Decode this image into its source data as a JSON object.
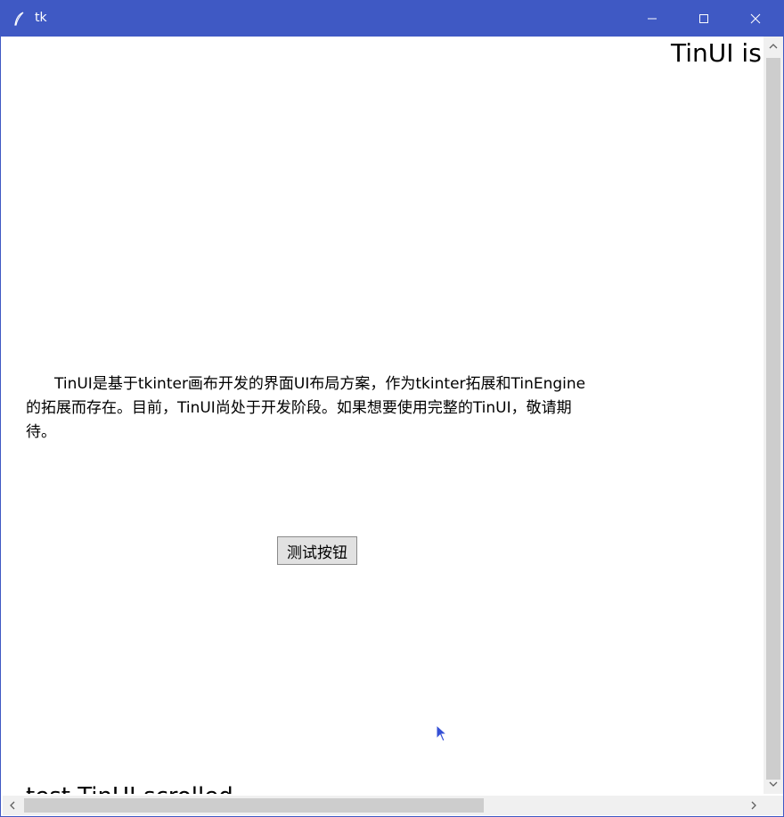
{
  "window": {
    "title": "tk",
    "icon": "feather-icon",
    "controls": [
      "minimize-icon",
      "maximize-icon",
      "close-icon"
    ]
  },
  "canvas": {
    "top_right_text": "TinUI is",
    "paragraph": "TinUI是基于tkinter画布开发的界面UI布局方案，作为tkinter拓展和TinEngine的拓展而存在。目前，TinUI尚处于开发阶段。如果想要使用完整的TinUI，敬请期待。",
    "button_label": "测试按钮",
    "bottom_text": "test TinUI scrolled"
  },
  "colors": {
    "titlebar": "#3f59c4",
    "button_bg": "#e1e1e1",
    "scroll_thumb": "#cdcdcd",
    "cursor": "#3550d6"
  },
  "scrollbars": {
    "vertical_thumb_fraction": 0.97,
    "horizontal_thumb_fraction": 0.63
  }
}
